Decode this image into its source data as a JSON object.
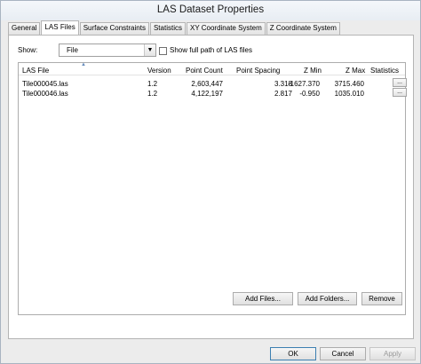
{
  "window": {
    "title": "LAS Dataset Properties"
  },
  "tabs": [
    "General",
    "LAS Files",
    "Surface Constraints",
    "Statistics",
    "XY Coordinate System",
    "Z Coordinate System"
  ],
  "show": {
    "label": "Show:",
    "selected": "File",
    "checkbox_label": "Show full path of LAS files",
    "checked": false
  },
  "table": {
    "columns": [
      "LAS File",
      "Version",
      "Point Count",
      "Point Spacing",
      "Z Min",
      "Z Max",
      "Statistics"
    ],
    "rows": [
      {
        "file": "Tile000045.las",
        "version": "1.2",
        "point_count": "2,603,447",
        "point_spacing": "3.318",
        "z_min": "-1627.370",
        "z_max": "3715.460",
        "stats_button": "..."
      },
      {
        "file": "Tile000046.las",
        "version": "1.2",
        "point_count": "4,122,197",
        "point_spacing": "2.817",
        "z_min": "-0.950",
        "z_max": "1035.010",
        "stats_button": "..."
      }
    ]
  },
  "actions": {
    "add_files": "Add Files...",
    "add_folders": "Add Folders...",
    "remove": "Remove"
  },
  "dialog": {
    "ok": "OK",
    "cancel": "Cancel",
    "apply": "Apply"
  }
}
